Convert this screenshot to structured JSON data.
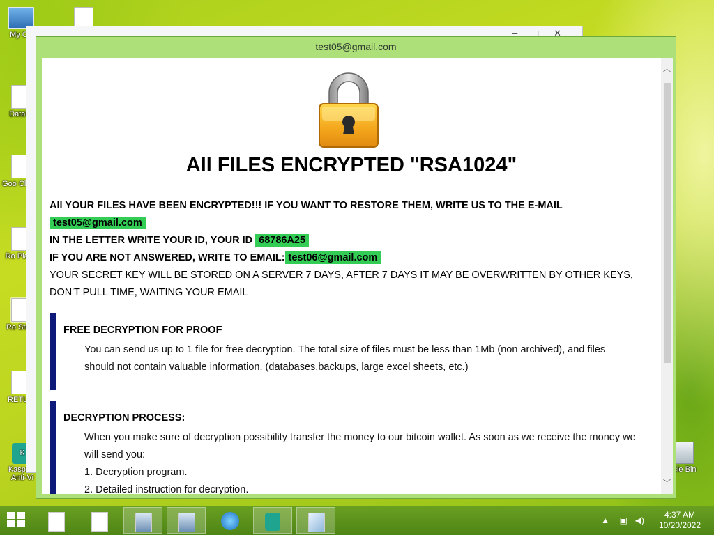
{
  "desktop": {
    "icons": [
      {
        "label": "My Co",
        "kind": "pc"
      },
      {
        "label": "DataW",
        "kind": "doc"
      },
      {
        "label": "Goo Chron",
        "kind": "doc"
      },
      {
        "label": "Ro Playe",
        "kind": "doc"
      },
      {
        "label": "Ro Studi",
        "kind": "doc"
      },
      {
        "label": "RETUR",
        "kind": "doc"
      },
      {
        "label": "Kaspers Anti-Vi",
        "kind": "kas"
      },
      {
        "label": "cle Bin",
        "kind": "bin"
      }
    ]
  },
  "window": {
    "title": "test05@gmail.com",
    "headline": "All FILES ENCRYPTED \"RSA1024\"",
    "intro": {
      "line1": "All YOUR FILES HAVE BEEN ENCRYPTED!!! IF YOU WANT TO RESTORE THEM, WRITE US TO THE E-MAIL",
      "email1": "test05@gmail.com",
      "id_label": "IN THE LETTER WRITE YOUR ID, YOUR ID",
      "id_value": "68786A25",
      "alt_label": "IF YOU ARE NOT ANSWERED, WRITE TO EMAIL:",
      "email2": "test06@gmail.com",
      "key_line1": "YOUR SECRET KEY WILL BE STORED ON A SERVER 7 DAYS, AFTER 7 DAYS IT MAY BE OVERWRITTEN BY OTHER KEYS,",
      "key_line2": "DON'T PULL TIME, WAITING YOUR EMAIL"
    },
    "sections": [
      {
        "title": "FREE DECRYPTION FOR PROOF",
        "lines": [
          "You can send us up to 1 file for free decryption. The total size of files must be less than 1Mb (non archived), and files",
          "should not contain valuable information. (databases,backups, large excel sheets, etc.)"
        ]
      },
      {
        "title": "DECRYPTION PROCESS:",
        "lines": [
          "When you make sure of decryption possibility transfer the money to our bitcoin wallet. As soon as we receive the money we",
          "will send you:",
          "1. Decryption program.",
          "2. Detailed instruction for decryption."
        ]
      }
    ]
  },
  "taskbar": {
    "time": "4:37 AM",
    "date": "10/20/2022"
  }
}
